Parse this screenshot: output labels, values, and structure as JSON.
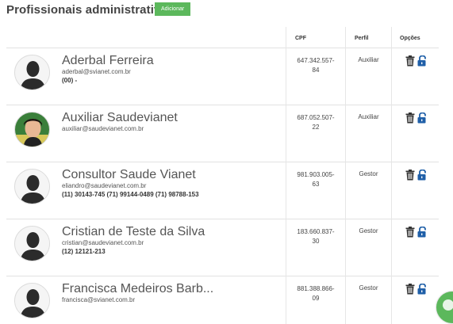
{
  "header": {
    "title": "Profissionais administrativos",
    "add_label": "Adicionar"
  },
  "columns": {
    "cpf": "CPF",
    "perfil": "Perfil",
    "opcoes": "Opções"
  },
  "rows": [
    {
      "name": "Aderbal Ferreira",
      "email": "aderbal@svianet.com.br",
      "phone": "(00) -",
      "cpf_line1": "647.342.557-",
      "cpf_line2": "84",
      "perfil": "Auxiliar",
      "avatar": "default-avatar"
    },
    {
      "name": "Auxiliar Saudevianet",
      "email": "auxiliar@saudevianet.com.br",
      "phone": "",
      "cpf_line1": "687.052.507-",
      "cpf_line2": "22",
      "perfil": "Auxiliar",
      "avatar": "photo-avatar"
    },
    {
      "name": "Consultor Saude Vianet",
      "email": "eliandro@saudevianet.com.br",
      "phone": "(11) 30143-745  (71) 99144-0489  (71) 98788-153",
      "cpf_line1": "981.903.005-",
      "cpf_line2": "63",
      "perfil": "Gestor",
      "avatar": "default-avatar"
    },
    {
      "name": "Cristian de Teste da Silva",
      "email": "cristian@saudevianet.com.br",
      "phone": "(12) 12121-213",
      "cpf_line1": "183.660.837-",
      "cpf_line2": "30",
      "perfil": "Gestor",
      "avatar": "default-avatar"
    },
    {
      "name": "Francisca Medeiros Barb...",
      "email": "francisca@svianet.com.br",
      "phone": "",
      "cpf_line1": "881.388.866-",
      "cpf_line2": "09",
      "perfil": "Gestor",
      "avatar": "default-avatar"
    }
  ],
  "icons": {
    "delete": "trash-icon",
    "unlock": "unlock-icon",
    "chat": "chat-icon"
  },
  "colors": {
    "add_button": "#5cb85c",
    "unlock_icon": "#1f5fa8",
    "trash_icon": "#333333"
  }
}
